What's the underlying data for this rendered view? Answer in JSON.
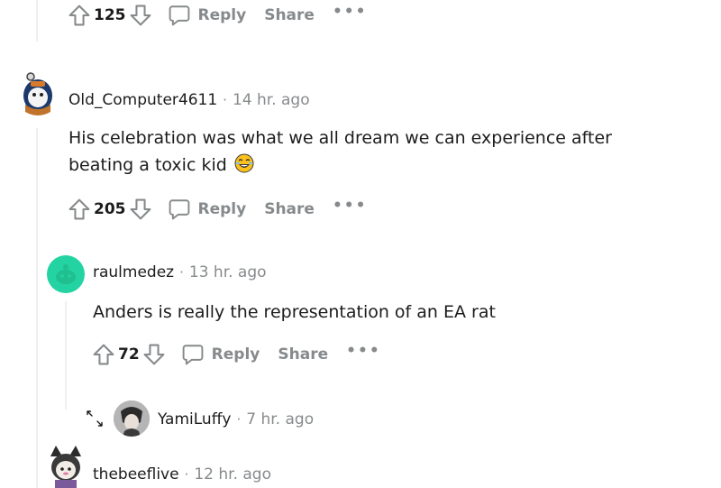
{
  "comments": [
    {
      "score": "125",
      "reply_label": "Reply",
      "share_label": "Share",
      "more_label": "•••"
    },
    {
      "username": "Old_Computer4611",
      "separator": "·",
      "time": "14 hr. ago",
      "body_line1": "His celebration was what we all dream we can experience after",
      "body_line2": "beating a toxic kid",
      "emoji": "joy-emoji",
      "score": "205",
      "reply_label": "Reply",
      "share_label": "Share",
      "more_label": "•••"
    },
    {
      "username": "raulmedez",
      "separator": "·",
      "time": "13 hr. ago",
      "body": "Anders is really the representation of an EA rat",
      "score": "72",
      "reply_label": "Reply",
      "share_label": "Share",
      "more_label": "•••"
    },
    {
      "username": "YamiLuffy",
      "separator": "·",
      "time": "7 hr. ago"
    },
    {
      "username": "thebeeflive",
      "separator": "·",
      "time": "12 hr. ago"
    }
  ],
  "colors": {
    "text": "#1c1c1c",
    "muted": "#878a8c",
    "thread_line": "#edeff1",
    "snoo_avatar": "#24d3a2"
  },
  "icons": {
    "upvote": "upvote-arrow-icon",
    "downvote": "downvote-arrow-icon",
    "reply": "speech-bubble-icon",
    "expand": "expand-arrows-icon"
  }
}
